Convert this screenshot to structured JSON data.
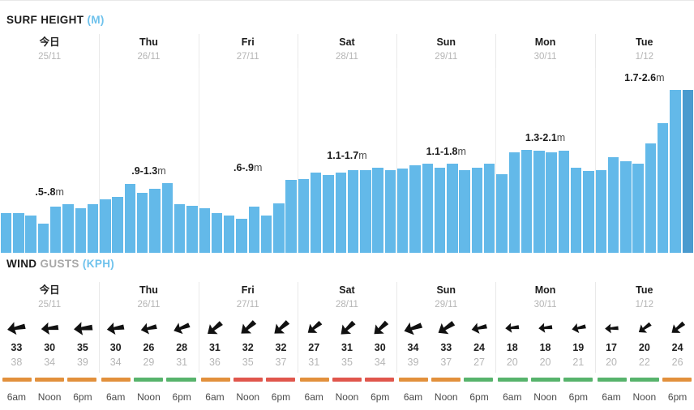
{
  "surf": {
    "title_strong": "SURF HEIGHT",
    "title_unit": "(M)"
  },
  "wind": {
    "title_strong": "WIND",
    "title_muted": "GUSTS",
    "title_unit": "(KPH)"
  },
  "colors": {
    "bar": "#63b9e9",
    "bar_accent": "#4a9bcf",
    "unit_accent": "#6fc2ec",
    "cond_good": "#57b36c",
    "cond_fair": "#e2903c",
    "cond_poor": "#e0564c",
    "divider": "#ececec"
  },
  "days": [
    {
      "name": "今日",
      "date": "25/11"
    },
    {
      "name": "Thu",
      "date": "26/11"
    },
    {
      "name": "Fri",
      "date": "27/11"
    },
    {
      "name": "Sat",
      "date": "28/11"
    },
    {
      "name": "Sun",
      "date": "29/11"
    },
    {
      "name": "Mon",
      "date": "30/11"
    },
    {
      "name": "Tue",
      "date": "1/12"
    }
  ],
  "time_labels": [
    "6am",
    "Noon",
    "6pm"
  ],
  "chart_data": {
    "type": "bar",
    "title": "SURF HEIGHT (M)",
    "ylabel": "Surf height (m)",
    "xlabel": "",
    "ylim": [
      0,
      2.9
    ],
    "grid": false,
    "legend": "none",
    "bars_per_day": 8,
    "categories": [
      "25/11",
      "26/11",
      "27/11",
      "28/11",
      "29/11",
      "30/11",
      "1/12"
    ],
    "values": [
      0.62,
      0.62,
      0.58,
      0.46,
      0.72,
      0.76,
      0.7,
      0.76,
      0.84,
      0.88,
      1.08,
      0.94,
      1.0,
      1.1,
      0.76,
      0.74,
      0.7,
      0.62,
      0.58,
      0.54,
      0.72,
      0.58,
      0.78,
      1.14,
      1.16,
      1.26,
      1.22,
      1.26,
      1.3,
      1.3,
      1.34,
      1.3,
      1.32,
      1.38,
      1.4,
      1.34,
      1.4,
      1.3,
      1.34,
      1.4,
      1.24,
      1.58,
      1.62,
      1.6,
      1.58,
      1.6,
      1.34,
      1.28,
      1.3,
      1.5,
      1.44,
      1.4,
      1.72,
      2.04,
      2.56,
      2.56
    ],
    "accent_bar_index": 55,
    "day_range_labels": [
      ".5-.8m",
      ".9-1.3m",
      ".6-.9m",
      "1.1-1.7m",
      "1.1-1.8m",
      "1.3-2.1m",
      "1.7-2.6m"
    ],
    "day_ranges": [
      {
        "min": 0.5,
        "max": 0.8,
        "unit": "m"
      },
      {
        "min": 0.9,
        "max": 1.3,
        "unit": "m"
      },
      {
        "min": 0.6,
        "max": 0.9,
        "unit": "m"
      },
      {
        "min": 1.1,
        "max": 1.7,
        "unit": "m"
      },
      {
        "min": 1.1,
        "max": 1.8,
        "unit": "m"
      },
      {
        "min": 1.3,
        "max": 2.1,
        "unit": "m"
      },
      {
        "min": 1.7,
        "max": 2.6,
        "unit": "m"
      }
    ]
  },
  "wind_data": {
    "type": "table",
    "unit": "kph",
    "rows_per_day": 3,
    "columns": [
      "6am",
      "Noon",
      "6pm"
    ],
    "entries": [
      {
        "day": "25/11",
        "time": "6am",
        "speed": 33,
        "gust": 38,
        "dir_deg": 260,
        "condition": "fair"
      },
      {
        "day": "25/11",
        "time": "Noon",
        "speed": 30,
        "gust": 34,
        "dir_deg": 265,
        "condition": "fair"
      },
      {
        "day": "25/11",
        "time": "6pm",
        "speed": 35,
        "gust": 39,
        "dir_deg": 265,
        "condition": "fair"
      },
      {
        "day": "26/11",
        "time": "6am",
        "speed": 30,
        "gust": 34,
        "dir_deg": 262,
        "condition": "fair"
      },
      {
        "day": "26/11",
        "time": "Noon",
        "speed": 26,
        "gust": 29,
        "dir_deg": 258,
        "condition": "good"
      },
      {
        "day": "26/11",
        "time": "6pm",
        "speed": 28,
        "gust": 31,
        "dir_deg": 250,
        "condition": "good"
      },
      {
        "day": "27/11",
        "time": "6am",
        "speed": 31,
        "gust": 36,
        "dir_deg": 232,
        "condition": "fair"
      },
      {
        "day": "27/11",
        "time": "Noon",
        "speed": 32,
        "gust": 35,
        "dir_deg": 230,
        "condition": "poor"
      },
      {
        "day": "27/11",
        "time": "6pm",
        "speed": 32,
        "gust": 37,
        "dir_deg": 230,
        "condition": "poor"
      },
      {
        "day": "28/11",
        "time": "6am",
        "speed": 27,
        "gust": 31,
        "dir_deg": 232,
        "condition": "fair"
      },
      {
        "day": "28/11",
        "time": "Noon",
        "speed": 31,
        "gust": 35,
        "dir_deg": 228,
        "condition": "poor"
      },
      {
        "day": "28/11",
        "time": "6pm",
        "speed": 30,
        "gust": 34,
        "dir_deg": 228,
        "condition": "poor"
      },
      {
        "day": "29/11",
        "time": "6am",
        "speed": 34,
        "gust": 39,
        "dir_deg": 252,
        "condition": "fair"
      },
      {
        "day": "29/11",
        "time": "Noon",
        "speed": 33,
        "gust": 37,
        "dir_deg": 238,
        "condition": "fair"
      },
      {
        "day": "29/11",
        "time": "6pm",
        "speed": 24,
        "gust": 27,
        "dir_deg": 258,
        "condition": "good"
      },
      {
        "day": "30/11",
        "time": "6am",
        "speed": 18,
        "gust": 20,
        "dir_deg": 265,
        "condition": "good"
      },
      {
        "day": "30/11",
        "time": "Noon",
        "speed": 18,
        "gust": 20,
        "dir_deg": 265,
        "condition": "good"
      },
      {
        "day": "30/11",
        "time": "6pm",
        "speed": 19,
        "gust": 21,
        "dir_deg": 258,
        "condition": "good"
      },
      {
        "day": "1/12",
        "time": "6am",
        "speed": 17,
        "gust": 20,
        "dir_deg": 268,
        "condition": "good"
      },
      {
        "day": "1/12",
        "time": "Noon",
        "speed": 20,
        "gust": 22,
        "dir_deg": 235,
        "condition": "good"
      },
      {
        "day": "1/12",
        "time": "6pm",
        "speed": 24,
        "gust": 26,
        "dir_deg": 232,
        "condition": "fair"
      }
    ]
  }
}
